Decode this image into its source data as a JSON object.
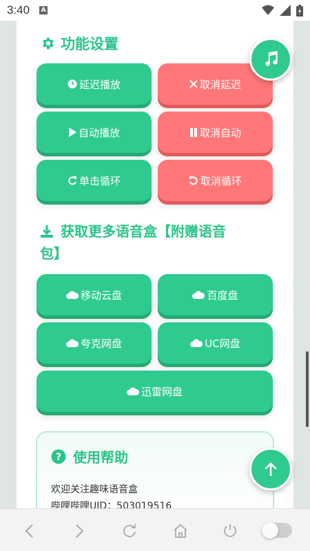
{
  "status_bar": {
    "time": "3:40",
    "notification_letter": "A"
  },
  "features": {
    "title": "功能设置",
    "buttons": [
      {
        "label": "延迟播放",
        "icon": "clock-icon",
        "color": "#2fcb8e"
      },
      {
        "label": "取消延迟",
        "icon": "close-icon",
        "color": "#ff7778"
      },
      {
        "label": "自动播放",
        "icon": "play-icon",
        "color": "#2fcb8e"
      },
      {
        "label": "取消自动",
        "icon": "pause-icon",
        "color": "#ff7778"
      },
      {
        "label": "单击循环",
        "icon": "redo-icon",
        "color": "#2fcb8e"
      },
      {
        "label": "取消循环",
        "icon": "undo-icon",
        "color": "#ff7778"
      }
    ]
  },
  "downloads": {
    "title_line1": "获取更多语音盒【附赠语音",
    "title_line2": "包】",
    "buttons": [
      {
        "label": "移动云盘",
        "icon": "cloud-icon"
      },
      {
        "label": "百度盘",
        "icon": "cloud-icon"
      },
      {
        "label": "夸克网盘",
        "icon": "cloud-icon"
      },
      {
        "label": "UC网盘",
        "icon": "cloud-icon"
      },
      {
        "label": "迅雷网盘",
        "icon": "cloud-icon"
      }
    ]
  },
  "help": {
    "title": "使用帮助",
    "line1": "欢迎关注趣味语音盒",
    "line2": "哔哩哔哩UID：503019516"
  },
  "colors": {
    "accent": "#2bc48a",
    "danger": "#ff7778"
  }
}
